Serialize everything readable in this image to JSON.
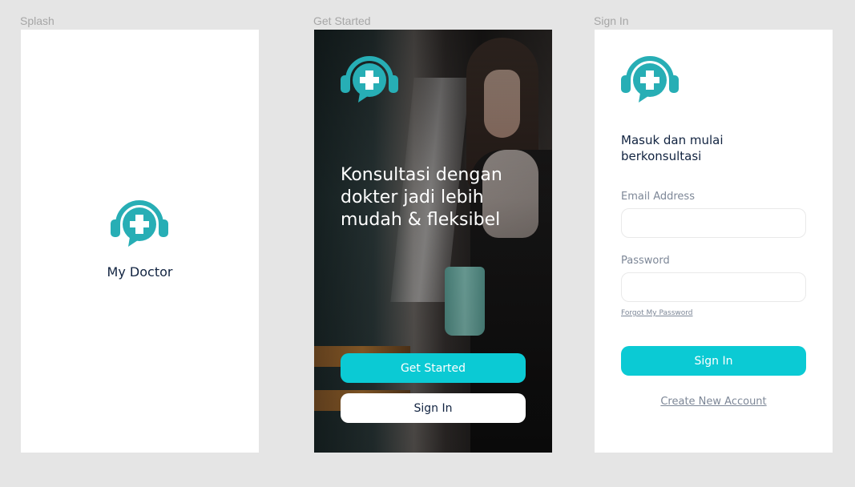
{
  "frames": {
    "splash_label": "Splash",
    "get_started_label": "Get Started",
    "sign_in_label": "Sign In"
  },
  "colors": {
    "primary": "#0bcad4",
    "logo": "#27aeb5",
    "text_dark": "#112340",
    "text_muted": "#7d8797",
    "canvas": "#e5e5e5"
  },
  "splash": {
    "logo_icon": "doctor-chat-plus-icon",
    "app_name": "My Doctor"
  },
  "get_started": {
    "logo_icon": "doctor-chat-plus-icon",
    "headline": "Konsultasi dengan dokter jadi lebih mudah & fleksibel",
    "get_started_button": "Get Started",
    "sign_in_button": "Sign In"
  },
  "sign_in": {
    "logo_icon": "doctor-chat-plus-icon",
    "heading": "Masuk dan mulai berkonsultasi",
    "email_label": "Email Address",
    "email_value": "",
    "password_label": "Password",
    "password_value": "",
    "forgot_link": "Forgot My Password",
    "sign_in_button": "Sign In",
    "create_account_link": "Create New Account"
  }
}
